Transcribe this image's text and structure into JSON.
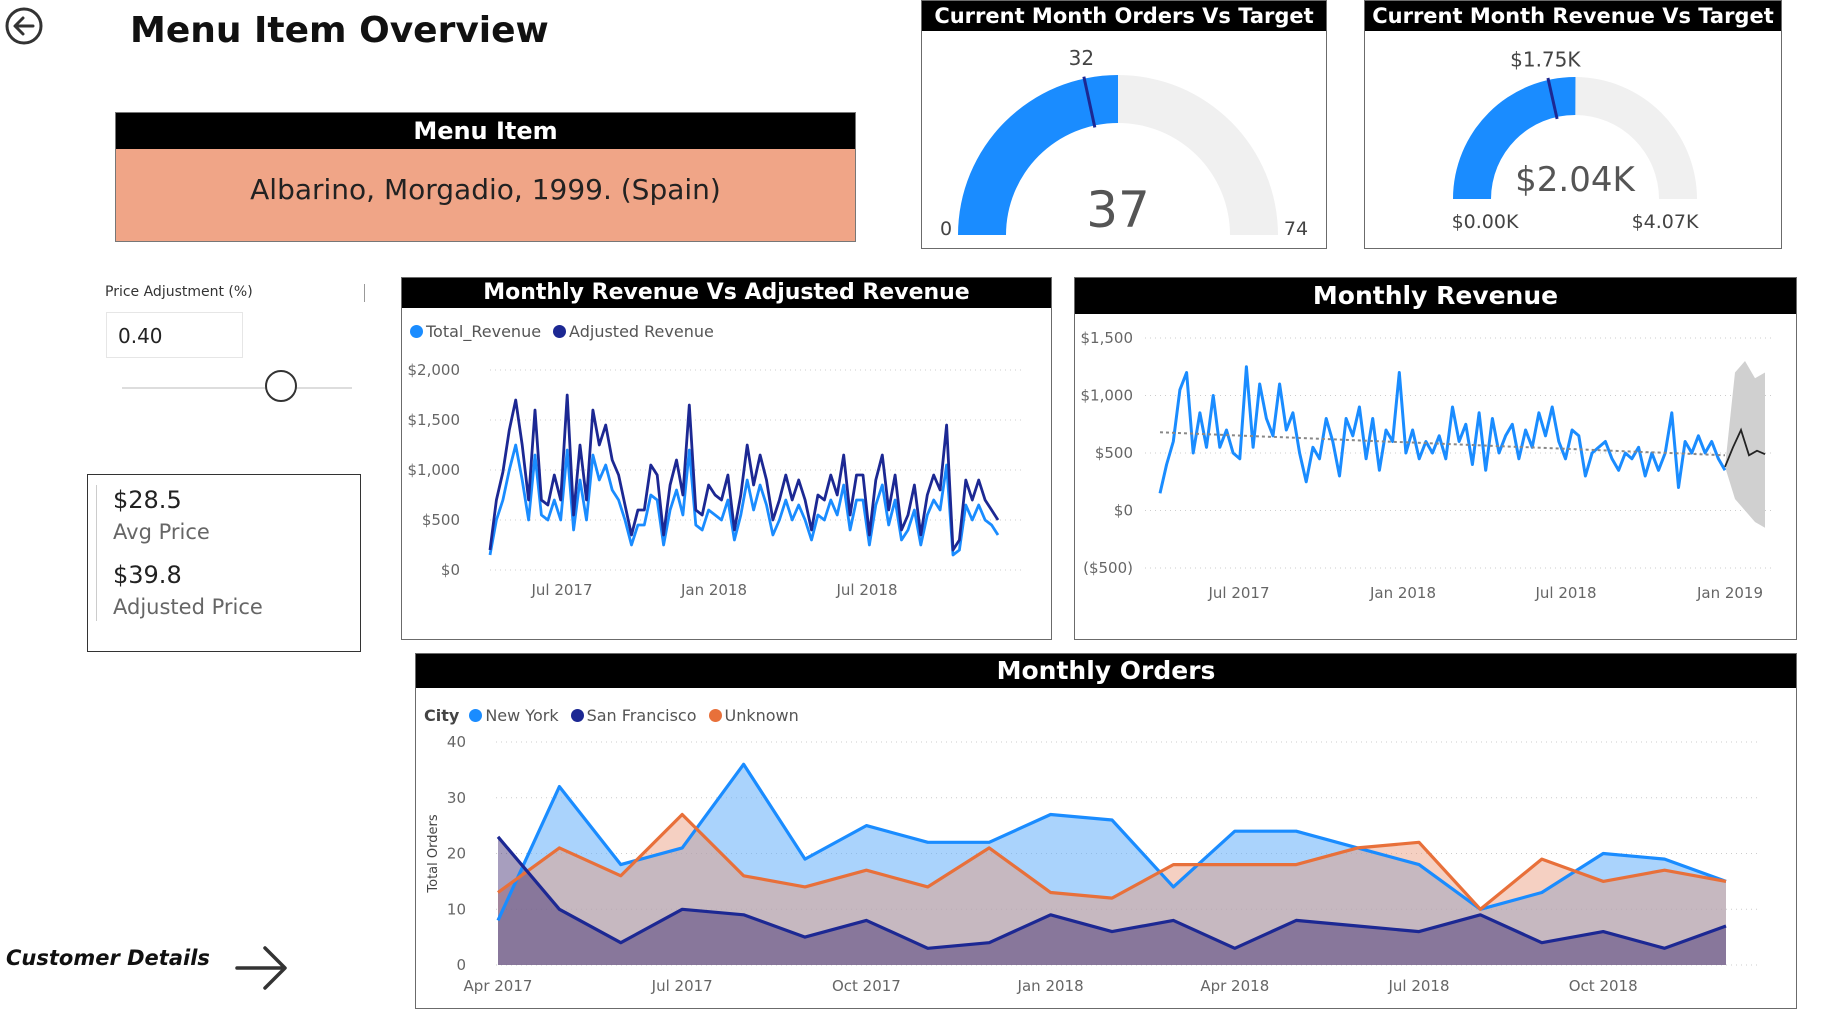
{
  "page": {
    "title": "Menu Item Overview",
    "back_icon": "arrow-left-circle-icon"
  },
  "menu_item": {
    "header": "Menu Item",
    "value": "Albarino, Morgadio, 1999. (Spain)"
  },
  "price_adjustment": {
    "label": "Price Adjustment (%)",
    "value": "0.40",
    "slider_fraction": 0.72
  },
  "price_card": {
    "avg_value": "$28.5",
    "avg_label": "Avg Price",
    "adj_value": "$39.8",
    "adj_label": "Adjusted Price"
  },
  "customer_link": {
    "label": "Customer Details",
    "icon": "arrow-right-icon"
  },
  "gauge_orders": {
    "title": "Current Month Orders Vs Target",
    "value": 37,
    "target": 32,
    "min": 0,
    "max": 74,
    "value_label": "37",
    "target_label": "32",
    "min_label": "0",
    "max_label": "74",
    "fill_color": "#1a8cff",
    "track_color": "#f0f0f0"
  },
  "gauge_revenue": {
    "title": "Current Month Revenue Vs Target",
    "value": 2.04,
    "target": 1.75,
    "min": 0,
    "max": 4.07,
    "value_label": "$2.04K",
    "target_label": "$1.75K",
    "min_label": "$0.00K",
    "max_label": "$4.07K",
    "fill_color": "#1a8cff",
    "track_color": "#f0f0f0"
  },
  "chart_data": [
    {
      "id": "monthly-revenue-vs-adjusted",
      "type": "line",
      "title": "Monthly Revenue Vs Adjusted Revenue",
      "legend": [
        "Total_Revenue",
        "Adjusted Revenue"
      ],
      "y_ticks": [
        "$2,000",
        "$1,500",
        "$1,000",
        "$500",
        "$0"
      ],
      "x_ticks": [
        "Jul 2017",
        "Jan 2018",
        "Jul 2018"
      ],
      "ylim": [
        0,
        2000
      ],
      "x_range": [
        "2017-04",
        "2018-12"
      ],
      "grid": true,
      "series": [
        {
          "name": "Total_Revenue",
          "color": "#1a8cff",
          "values": [
            150,
            500,
            700,
            1000,
            1250,
            900,
            500,
            1150,
            550,
            500,
            700,
            500,
            1200,
            400,
            900,
            500,
            1150,
            900,
            1050,
            800,
            700,
            500,
            250,
            450,
            450,
            750,
            700,
            250,
            600,
            800,
            550,
            1200,
            450,
            400,
            600,
            550,
            500,
            700,
            300,
            550,
            900,
            600,
            850,
            650,
            350,
            500,
            700,
            500,
            650,
            500,
            300,
            550,
            500,
            700,
            550,
            850,
            400,
            700,
            700,
            250,
            650,
            850,
            450,
            700,
            300,
            400,
            600,
            250,
            550,
            700,
            600,
            1050,
            150,
            200,
            650,
            500,
            650,
            500,
            450,
            350
          ]
        },
        {
          "name": "Adjusted Revenue",
          "color": "#1c2893",
          "values": [
            200,
            700,
            980,
            1400,
            1700,
            1250,
            700,
            1600,
            700,
            650,
            950,
            700,
            1750,
            550,
            1250,
            700,
            1600,
            1250,
            1450,
            1100,
            950,
            650,
            350,
            600,
            600,
            1050,
            950,
            350,
            850,
            1100,
            750,
            1650,
            600,
            550,
            850,
            750,
            700,
            950,
            400,
            750,
            1250,
            850,
            1150,
            900,
            500,
            700,
            950,
            700,
            900,
            700,
            400,
            750,
            700,
            950,
            750,
            1150,
            550,
            950,
            950,
            350,
            900,
            1150,
            600,
            950,
            400,
            550,
            850,
            350,
            750,
            950,
            800,
            1450,
            200,
            300,
            900,
            700,
            900,
            700,
            600,
            500
          ]
        }
      ]
    },
    {
      "id": "monthly-revenue",
      "type": "line",
      "title": "Monthly Revenue",
      "y_ticks": [
        "$1,500",
        "$1,000",
        "$500",
        "$0",
        "($500)"
      ],
      "x_ticks": [
        "Jul 2017",
        "Jan 2018",
        "Jul 2018",
        "Jan 2019"
      ],
      "ylim": [
        -500,
        1500
      ],
      "x_range": [
        "2017-04",
        "2019-02"
      ],
      "grid": true,
      "trend_start": 680,
      "trend_end": 480,
      "series": [
        {
          "name": "Revenue",
          "color": "#1a8cff",
          "values": [
            150,
            400,
            600,
            1050,
            1200,
            500,
            850,
            550,
            1000,
            550,
            700,
            500,
            450,
            1250,
            550,
            1100,
            800,
            650,
            1100,
            700,
            850,
            500,
            250,
            550,
            450,
            800,
            600,
            300,
            800,
            650,
            900,
            450,
            800,
            350,
            700,
            600,
            1200,
            500,
            700,
            450,
            600,
            500,
            650,
            450,
            900,
            600,
            750,
            400,
            850,
            350,
            800,
            500,
            650,
            750,
            450,
            700,
            550,
            850,
            650,
            900,
            600,
            450,
            700,
            650,
            300,
            500,
            550,
            600,
            450,
            350,
            500,
            450,
            550,
            300,
            500,
            350,
            500,
            850,
            200,
            600,
            500,
            650,
            500,
            600,
            450,
            350
          ]
        }
      ],
      "forecast": {
        "values": [
          380,
          550,
          700,
          480,
          520,
          490
        ],
        "color": "#222222",
        "band_color": "#d0d0d0"
      }
    },
    {
      "id": "monthly-orders",
      "type": "area",
      "title": "Monthly Orders",
      "legend_title": "City",
      "ylabel": "Total Orders",
      "y_ticks": [
        40,
        30,
        20,
        10,
        0
      ],
      "ylim": [
        0,
        40
      ],
      "x_ticks": [
        "Apr 2017",
        "Jul 2017",
        "Oct 2017",
        "Jan 2018",
        "Apr 2018",
        "Jul 2018",
        "Oct 2018"
      ],
      "categories": [
        "Apr 2017",
        "May 2017",
        "Jun 2017",
        "Jul 2017",
        "Aug 2017",
        "Sep 2017",
        "Oct 2017",
        "Nov 2017",
        "Dec 2017",
        "Jan 2018",
        "Feb 2018",
        "Mar 2018",
        "Apr 2018",
        "May 2018",
        "Jun 2018",
        "Jul 2018",
        "Aug 2018",
        "Sep 2018",
        "Oct 2018",
        "Nov 2018",
        "Dec 2018"
      ],
      "grid": true,
      "series": [
        {
          "name": "New York",
          "color": "#1a8cff",
          "fill": "rgba(100,175,250,0.55)",
          "values": [
            8,
            32,
            18,
            21,
            36,
            19,
            25,
            22,
            22,
            27,
            26,
            14,
            24,
            24,
            21,
            18,
            10,
            13,
            20,
            19,
            15
          ]
        },
        {
          "name": "San Francisco",
          "color": "#1c2893",
          "fill": "rgba(60,40,110,0.45)",
          "values": [
            23,
            10,
            4,
            10,
            9,
            5,
            8,
            3,
            4,
            9,
            6,
            8,
            3,
            8,
            7,
            6,
            9,
            4,
            6,
            3,
            7
          ]
        },
        {
          "name": "Unknown",
          "color": "#e8703a",
          "fill": "rgba(232,150,120,0.45)",
          "values": [
            13,
            21,
            16,
            27,
            16,
            14,
            17,
            14,
            21,
            13,
            12,
            18,
            18,
            18,
            21,
            22,
            10,
            19,
            15,
            17,
            15
          ]
        }
      ]
    }
  ]
}
